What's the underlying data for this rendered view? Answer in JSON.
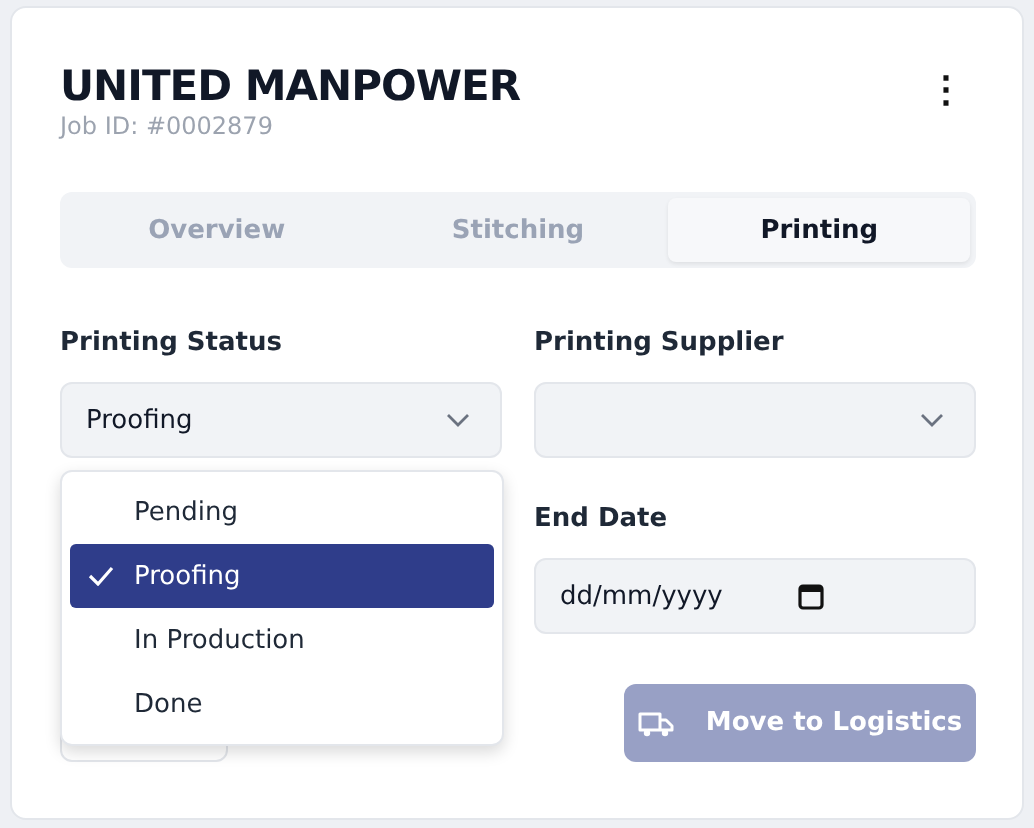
{
  "header": {
    "title": "UNITED MANPOWER",
    "job_id": "Job ID: #0002879",
    "menu_icon": "⋮"
  },
  "tabs": [
    {
      "label": "Overview",
      "selected": false
    },
    {
      "label": "Stitching",
      "selected": false
    },
    {
      "label": "Printing",
      "selected": true
    }
  ],
  "printing_status": {
    "label": "Printing Status",
    "value": "Proofing",
    "expanded": true,
    "options": [
      {
        "label": "Pending",
        "selected": false
      },
      {
        "label": "Proofing",
        "selected": true
      },
      {
        "label": "In Production",
        "selected": false
      },
      {
        "label": "Done",
        "selected": false
      }
    ]
  },
  "printing_supplier": {
    "label": "Printing Supplier"
  },
  "end_date": {
    "label": "End Date",
    "placeholder": "dd/mm/yyyy"
  },
  "move_button": {
    "label": "Move to Logistics",
    "disabled": true
  }
}
